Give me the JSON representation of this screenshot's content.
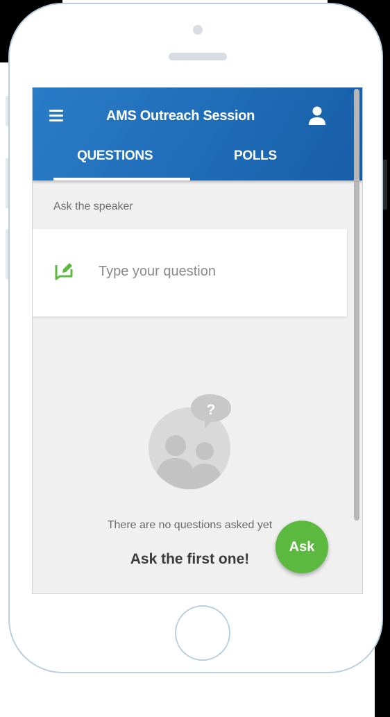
{
  "header": {
    "title": "AMS Outreach Session",
    "menu_icon": "hamburger-menu-icon",
    "user_icon": "user-icon",
    "color": "#1e6ab5"
  },
  "tabs": [
    {
      "label": "QUESTIONS",
      "active": true
    },
    {
      "label": "POLLS",
      "active": false
    }
  ],
  "ask_section": {
    "label": "Ask the speaker",
    "input_placeholder": "Type your question",
    "icon": "edit-icon",
    "icon_color": "#5cb940"
  },
  "empty_state": {
    "message": "There are no questions asked yet",
    "cta": "Ask the first one!",
    "illustration_icon": "people-question-icon"
  },
  "fab": {
    "label": "Ask",
    "color": "#5cb940"
  }
}
